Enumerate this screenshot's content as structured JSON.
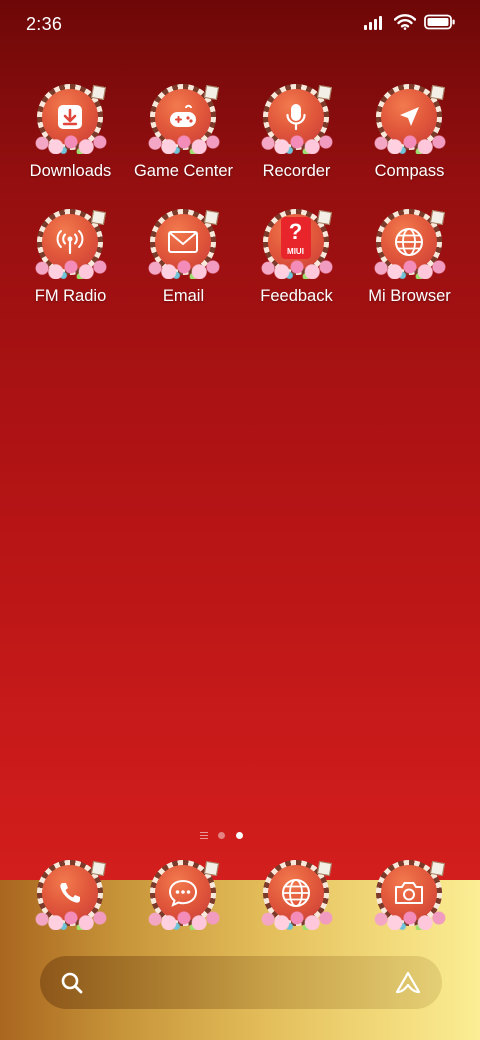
{
  "status_bar": {
    "time": "2:36",
    "icons": [
      "signal-icon",
      "wifi-icon",
      "battery-icon"
    ]
  },
  "home": {
    "rows": [
      [
        {
          "label": "Downloads",
          "icon": "download-icon"
        },
        {
          "label": "Game Center",
          "icon": "gamepad-icon"
        },
        {
          "label": "Recorder",
          "icon": "microphone-icon"
        },
        {
          "label": "Compass",
          "icon": "compass-arrow-icon"
        }
      ],
      [
        {
          "label": "FM Radio",
          "icon": "radio-antenna-icon"
        },
        {
          "label": "Email",
          "icon": "envelope-icon"
        },
        {
          "label": "Feedback",
          "icon": "question-icon"
        },
        {
          "label": "Mi Browser",
          "icon": "globe-icon"
        }
      ]
    ],
    "feedback_badge": "MIUI"
  },
  "page_indicator": {
    "pages": 2,
    "current": 2
  },
  "dock": {
    "apps": [
      {
        "name": "Phone",
        "icon": "phone-icon"
      },
      {
        "name": "Messages",
        "icon": "chat-bubble-icon"
      },
      {
        "name": "Browser",
        "icon": "globe-icon"
      },
      {
        "name": "Camera",
        "icon": "camera-icon"
      }
    ]
  },
  "search": {
    "icons": [
      "search-icon",
      "assistant-icon"
    ]
  },
  "colors": {
    "background_top": "#6e0808",
    "background_bottom": "#d21e1c",
    "icon_disc": "#e25a3c",
    "dock_gold": "#e3bd5a"
  }
}
